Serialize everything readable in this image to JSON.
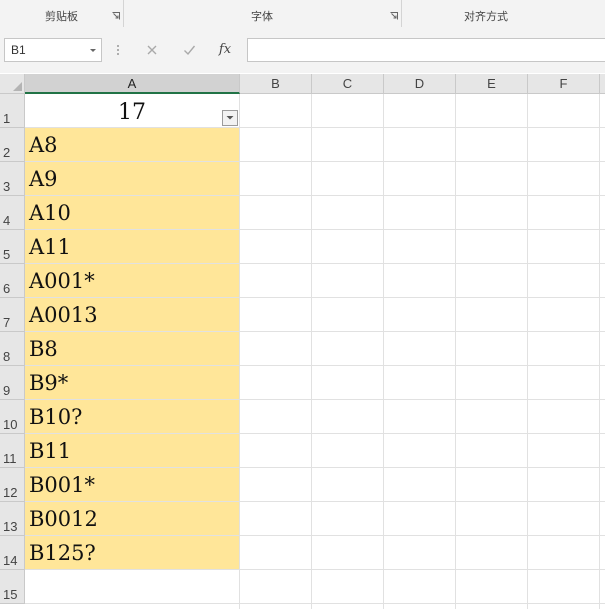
{
  "ribbon": {
    "groups": [
      {
        "label": "剪贴板"
      },
      {
        "label": "字体"
      },
      {
        "label": "对齐方式"
      }
    ]
  },
  "formula_bar": {
    "name_box": "B1",
    "cancel_icon": "x-icon",
    "enter_icon": "check-icon",
    "function_label": "fx",
    "formula_value": ""
  },
  "sheet": {
    "columns": [
      "A",
      "B",
      "C",
      "D",
      "E",
      "F"
    ],
    "rows": [
      "1",
      "2",
      "3",
      "4",
      "5",
      "6",
      "7",
      "8",
      "9",
      "10",
      "11",
      "12",
      "13",
      "14",
      "15"
    ],
    "header_value": "17",
    "values": [
      "A8",
      "A9",
      "A10",
      "A11",
      "A001*",
      "A0013",
      "B8",
      "B9*",
      "B10?",
      "B11",
      "B001*",
      "B0012",
      "B125?"
    ],
    "fill_color": "#ffe699",
    "selected_column": "A"
  }
}
